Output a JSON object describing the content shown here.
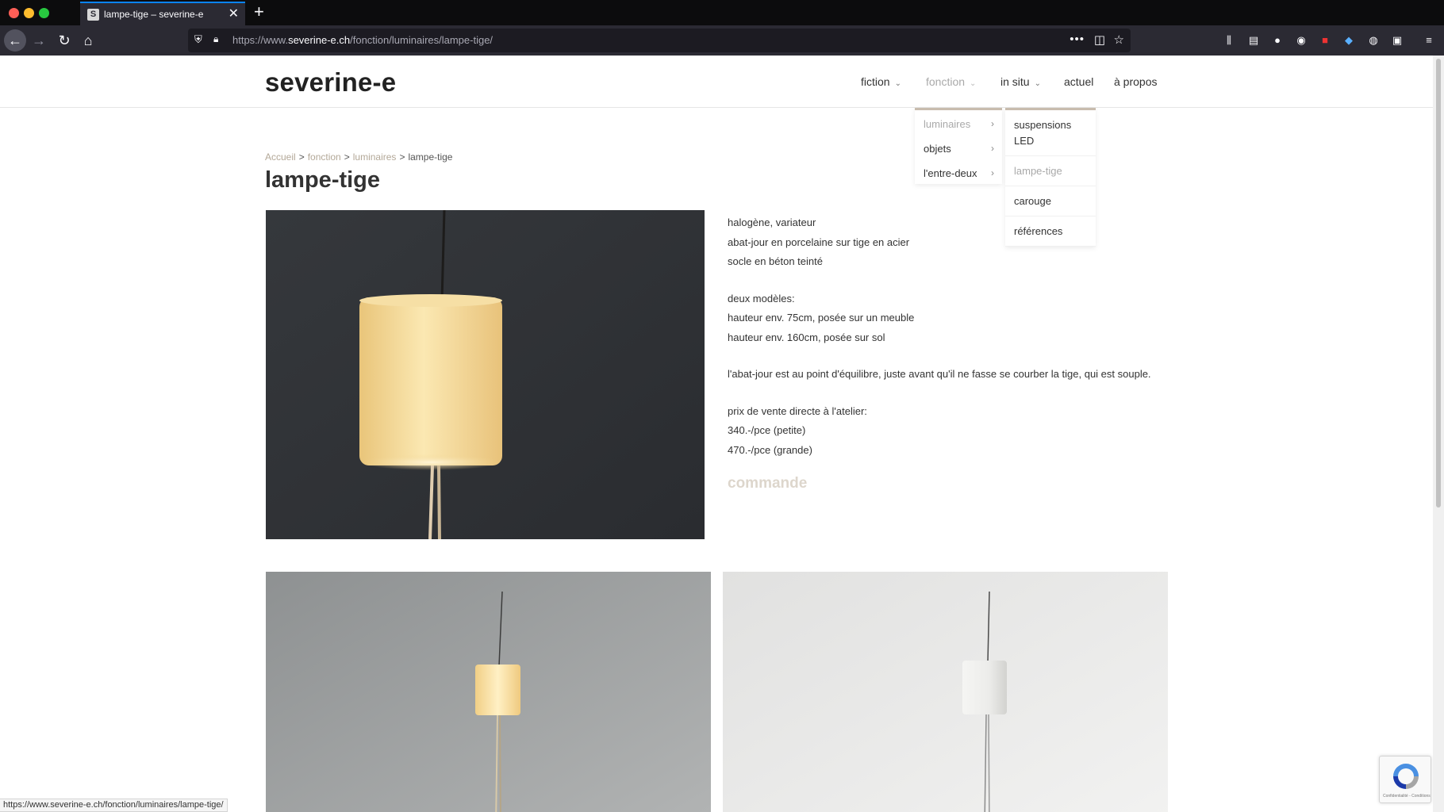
{
  "browser": {
    "tab_title": "lampe-tige – severine-e",
    "tab_favicon_letter": "S",
    "url_prefix": "https://www.",
    "url_domain": "severine-e.ch",
    "url_path": "/fonction/luminaires/lampe-tige/",
    "status_url": "https://www.severine-e.ch/fonction/luminaires/lampe-tige/"
  },
  "site": {
    "logo": "severine-e",
    "menu": [
      {
        "label": "fiction"
      },
      {
        "label": "fonction"
      },
      {
        "label": "in situ"
      },
      {
        "label": "actuel"
      },
      {
        "label": "à propos"
      }
    ],
    "dropdown_level1": [
      "luminaires",
      "objets",
      "l'entre-deux"
    ],
    "dropdown_level2": [
      "suspensions LED",
      "lampe-tige",
      "carouge",
      "références"
    ]
  },
  "breadcrumb": {
    "items": [
      "Accueil",
      "fonction",
      "luminaires"
    ],
    "current": "lampe-tige",
    "separator": ">"
  },
  "product": {
    "title": "lampe-tige",
    "lines": [
      "halogène, variateur",
      "abat-jour en porcelaine sur tige en acier",
      "socle en béton teinté",
      "deux modèles:",
      "hauteur env. 75cm, posée sur un meuble",
      "hauteur env. 160cm, posée sur sol",
      "l'abat-jour est au point d'équilibre, juste avant qu'il ne fasse se courber la tige, qui est souple.",
      "prix de vente directe à l'atelier:",
      "340.-/pce (petite)",
      "470.-/pce (grande)"
    ],
    "order_label": "commande"
  },
  "recaptcha": {
    "text": "Confidentialité - Conditions"
  },
  "colors": {
    "accent_taupe": "#b3a898",
    "muted_gray": "#a9a9a9",
    "order_label": "#ddd6cc"
  }
}
